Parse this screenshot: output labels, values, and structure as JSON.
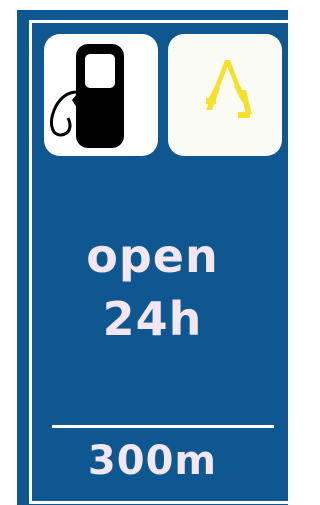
{
  "sign": {
    "background_color": "#0f5791",
    "text_color": "#f3e6ee",
    "icons": {
      "fuel": "fuel-pump-icon",
      "brand": "brand-logo-icon",
      "brand_color": "#f5e02a"
    },
    "status_line_1": "open",
    "status_line_2": "24h",
    "distance": "300m"
  }
}
